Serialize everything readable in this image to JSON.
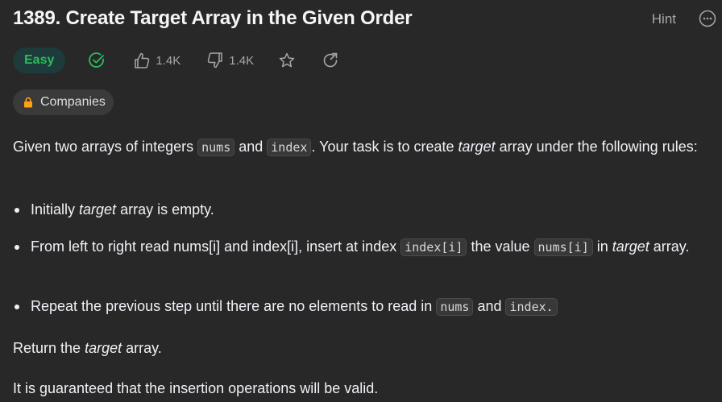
{
  "problem": {
    "title": "1389. Create Target Array in the Given Order",
    "hint_label": "Hint",
    "difficulty": "Easy",
    "likes": "1.4K",
    "dislikes": "1.4K",
    "companies_label": "Companies"
  },
  "description": {
    "p1": {
      "t1": "Given two arrays of integers ",
      "c1": "nums",
      "t2": " and ",
      "c2": "index",
      "t3": ". Your task is to create ",
      "em1": "target",
      "t4": " array under the following rules:"
    },
    "bullet1": {
      "t1": "Initially ",
      "em1": "target",
      "t2": " array is empty."
    },
    "bullet2": {
      "t1": "From left to right read nums[i] and index[i], insert at index ",
      "c1": "index[i]",
      "t2": " the value ",
      "c2": "nums[i]",
      "t3": " in ",
      "em1": "target",
      "t4": " array."
    },
    "bullet3": {
      "t1": "Repeat the previous step until there are no elements to read in ",
      "c1": "nums",
      "t2": " and ",
      "c2": "index."
    },
    "p2": {
      "t1": "Return the ",
      "em1": "target",
      "t2": " array."
    },
    "p3": "It is guaranteed that the insertion operations will be valid."
  },
  "colors": {
    "background": "#282828",
    "easy_green": "#2cbb5d",
    "muted": "#a7a7a7",
    "lock_orange": "#ffa116"
  }
}
